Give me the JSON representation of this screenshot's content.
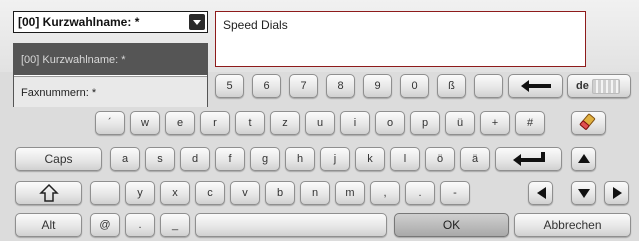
{
  "dropdown": {
    "selected": "[00] Kurzwahlname: *"
  },
  "menu": {
    "items": [
      "[00] Kurzwahlname: *",
      "Faxnummern: *"
    ]
  },
  "textarea": {
    "value": "Speed Dials"
  },
  "keyboard": {
    "row1": [
      "5",
      "6",
      "7",
      "8",
      "9",
      "0",
      "ß",
      ""
    ],
    "row2": [
      "´",
      "w",
      "e",
      "r",
      "t",
      "z",
      "u",
      "i",
      "o",
      "p",
      "ü",
      "+",
      "#"
    ],
    "row3": [
      "a",
      "s",
      "d",
      "f",
      "g",
      "h",
      "j",
      "k",
      "l",
      "ö",
      "ä"
    ],
    "row4": [
      "",
      "y",
      "x",
      "c",
      "v",
      "b",
      "n",
      "m",
      ",",
      ".",
      "-"
    ],
    "caps": "Caps",
    "alt": "Alt",
    "at": "@",
    "dot": ".",
    "underscore": "_",
    "lang": "de",
    "ok": "OK",
    "cancel": "Abbrechen"
  },
  "icons": {
    "backspace": "left-arrow-icon",
    "enter": "enter-icon",
    "shift": "shift-icon",
    "clear": "eraser-icon",
    "up": "up-arrow-icon",
    "down": "down-arrow-icon",
    "left": "left-arrow-icon",
    "right": "right-arrow-icon",
    "keyboard": "keyboard-icon"
  }
}
